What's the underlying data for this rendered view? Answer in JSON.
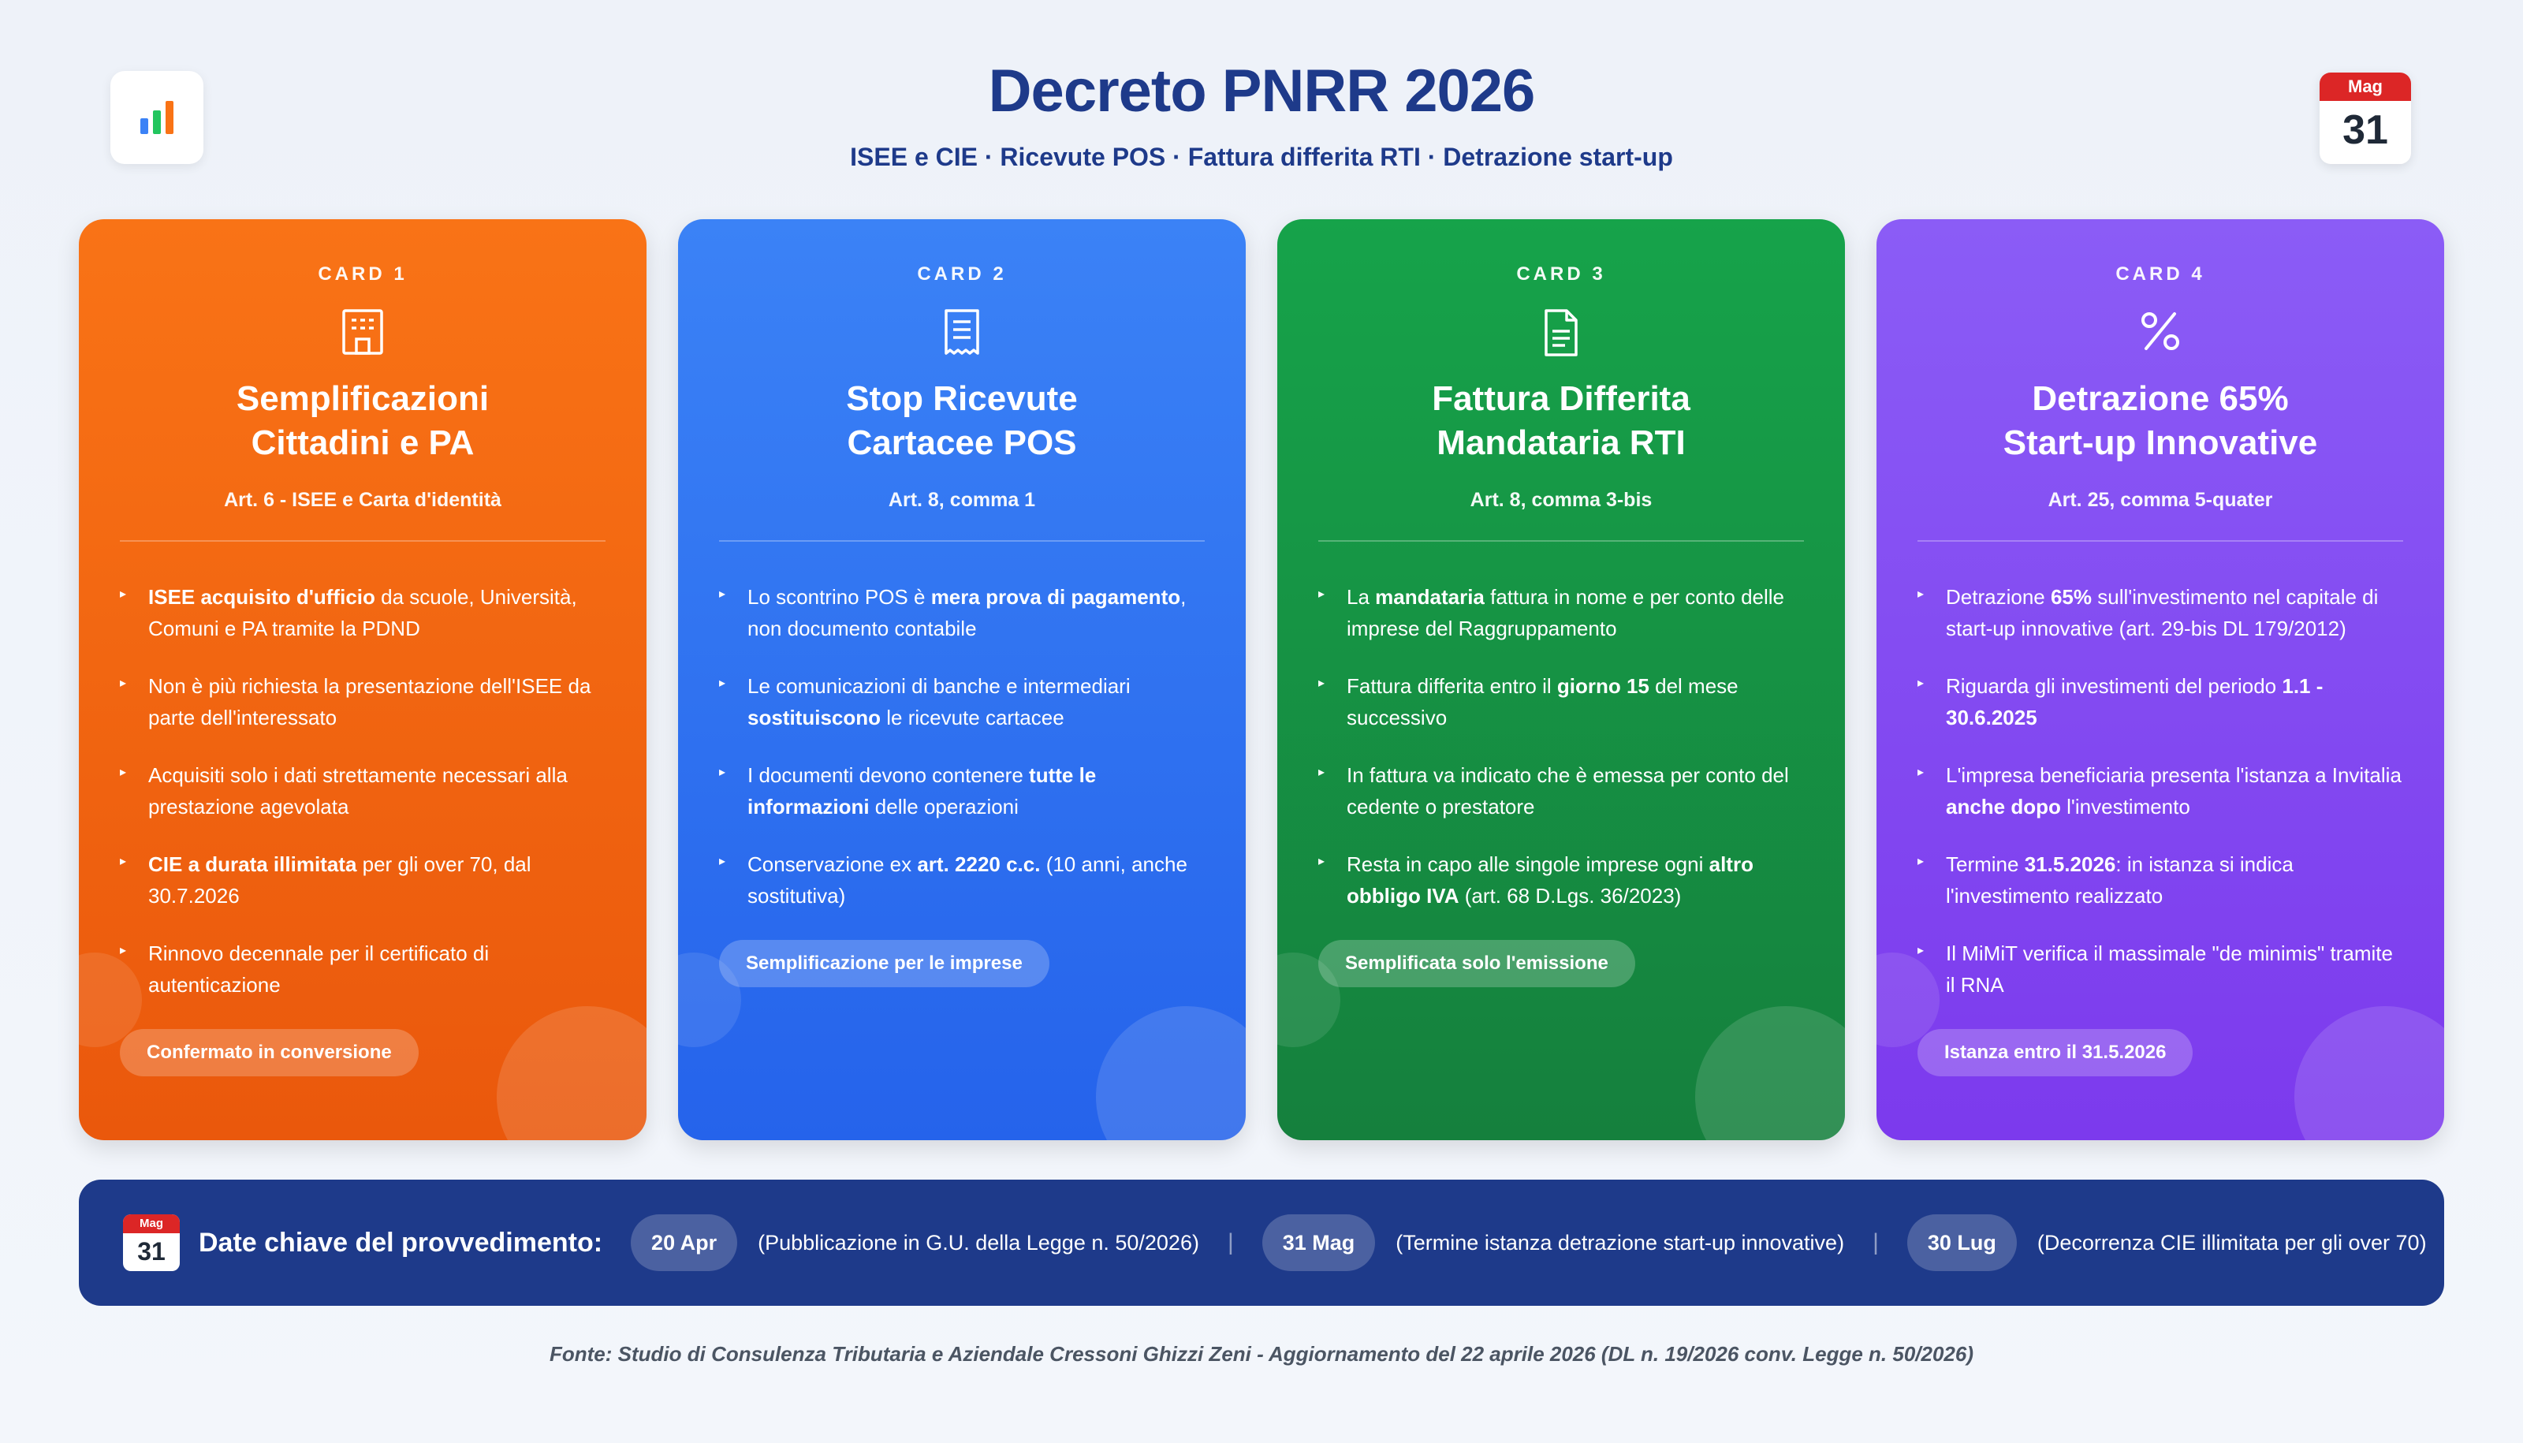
{
  "header": {
    "title": "Decreto PNRR 2026",
    "subtitle": "ISEE e CIE · Ricevute POS · Fattura differita RTI · Detrazione start-up",
    "logo_icon": "bar-chart-icon",
    "calendar": {
      "month": "Mag",
      "day": "31"
    }
  },
  "cards": [
    {
      "num": "CARD 1",
      "icon": "building-icon",
      "title_line1": "Semplificazioni",
      "title_line2": "Cittadini e PA",
      "ref": "Art. 6 - ISEE e Carta d'identità",
      "color": "#f97316",
      "bullets": [
        {
          "b": "ISEE acquisito d'ufficio",
          "t": " da scuole, Università, Comuni e PA tramite la PDND"
        },
        {
          "t": "Non è più richiesta la presentazione dell'ISEE da parte dell'interessato"
        },
        {
          "t": "Acquisiti solo i dati strettamente necessari alla prestazione agevolata"
        },
        {
          "b": "CIE a durata illimitata",
          "t": " per gli over 70, dal 30.7.2026"
        },
        {
          "t": "Rinnovo decennale per il certificato di autenticazione"
        }
      ],
      "pill": "Confermato in conversione"
    },
    {
      "num": "CARD 2",
      "icon": "receipt-icon",
      "title_line1": "Stop Ricevute",
      "title_line2": "Cartacee POS",
      "ref": "Art. 8, comma 1",
      "color": "#3b82f6",
      "bullets": [
        {
          "t": "Lo scontrino POS è ",
          "b": "mera prova di pagamento",
          "t2": ", non documento contabile"
        },
        {
          "t": "Le comunicazioni di banche e intermediari ",
          "b": "sostituiscono",
          "t2": " le ricevute cartacee"
        },
        {
          "t": "I documenti devono contenere ",
          "b": "tutte le informazioni",
          "t2": " delle operazioni"
        },
        {
          "t": "Conservazione ex ",
          "b": "art. 2220 c.c.",
          "t2": " (10 anni, anche sostitutiva)"
        }
      ],
      "pill": "Semplificazione per le imprese"
    },
    {
      "num": "CARD 3",
      "icon": "document-icon",
      "title_line1": "Fattura Differita",
      "title_line2": "Mandataria RTI",
      "ref": "Art. 8, comma 3-bis",
      "color": "#16a34a",
      "bullets": [
        {
          "t": "La ",
          "b": "mandataria",
          "t2": " fattura in nome e per conto delle imprese del Raggruppamento"
        },
        {
          "t": "Fattura differita entro il ",
          "b": "giorno 15",
          "t2": " del mese successivo"
        },
        {
          "t": "In fattura va indicato che è emessa per conto del cedente o prestatore"
        },
        {
          "t": "Resta in capo alle singole imprese ogni ",
          "b": "altro obbligo IVA",
          "t2": " (art. 68 D.Lgs. 36/2023)"
        }
      ],
      "pill": "Semplificata solo l'emissione"
    },
    {
      "num": "CARD 4",
      "icon": "percent-icon",
      "title_line1": "Detrazione 65%",
      "title_line2": "Start-up Innovative",
      "ref": "Art. 25, comma 5-quater",
      "color": "#8b5cf6",
      "bullets": [
        {
          "t": "Detrazione ",
          "b": "65%",
          "t2": " sull'investimento nel capitale di start-up innovative (art. 29-bis DL 179/2012)"
        },
        {
          "t": "Riguarda gli investimenti del periodo ",
          "b": "1.1 - 30.6.2025"
        },
        {
          "t": "L'impresa beneficiaria presenta l'istanza a Invitalia ",
          "b": "anche dopo",
          "t2": " l'investimento"
        },
        {
          "t": "Termine ",
          "b": "31.5.2026",
          "t2": ": in istanza si indica l'investimento realizzato"
        },
        {
          "t": "Il MiMiT verifica il massimale \"de minimis\" tramite il RNA"
        }
      ],
      "pill": "Istanza entro il 31.5.2026"
    }
  ],
  "datebar": {
    "calendar": {
      "month": "Mag",
      "day": "31"
    },
    "label": "Date chiave del provvedimento:",
    "dates": [
      {
        "chip": "20 Apr",
        "desc": "(Pubblicazione in G.U. della Legge n. 50/2026)"
      },
      {
        "chip": "31 Mag",
        "desc": "(Termine istanza detrazione start-up innovative)"
      },
      {
        "chip": "30 Lug",
        "desc": "(Decorrenza CIE illimitata per gli over 70)"
      }
    ],
    "separator": "|"
  },
  "source": "Fonte: Studio di Consulenza Tributaria e Aziendale Cressoni Ghizzi Zeni - Aggiornamento del 22 aprile 2026 (DL n. 19/2026 conv. Legge n. 50/2026)"
}
